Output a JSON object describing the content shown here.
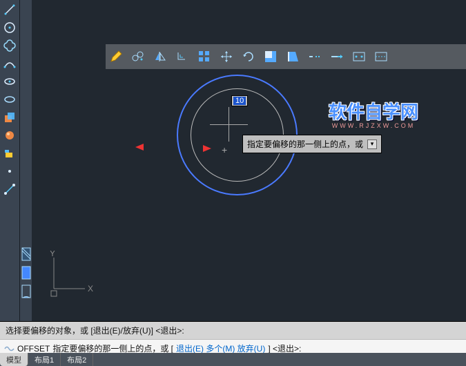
{
  "left_tools": [
    "line",
    "circle",
    "blob",
    "spline",
    "ellipse",
    "ellipse-arc",
    "box-combo",
    "sphere",
    "wedge",
    "point",
    "line2"
  ],
  "panel_tools": [
    "hatch",
    "square",
    "arc-shape"
  ],
  "ribbon_tools": [
    "pencil",
    "curve-pts",
    "mirror",
    "crop",
    "grid4",
    "move",
    "rotate",
    "rect-half",
    "page",
    "dash1",
    "arrow-line",
    "rect-out",
    "dash2"
  ],
  "dimension": {
    "value": "10"
  },
  "tooltip": {
    "text": "指定要偏移的那一侧上的点，或"
  },
  "ucs": {
    "x": "X",
    "y": "Y"
  },
  "cmdline": {
    "line1": "选择要偏移的对象，或 [退出(E)/放弃(U)] <退出>:",
    "prefix": "OFFSET ",
    "body": "指定要偏移的那一侧上的点，或 [",
    "opts": "退出(E) 多个(M) 放弃(U)",
    "tail": "] <退出>:"
  },
  "status": {
    "tabs": [
      "模型",
      "布局1",
      "布局2"
    ]
  },
  "watermark": {
    "main": "软件自学网",
    "sub": "WWW.RJZXW.COM"
  }
}
